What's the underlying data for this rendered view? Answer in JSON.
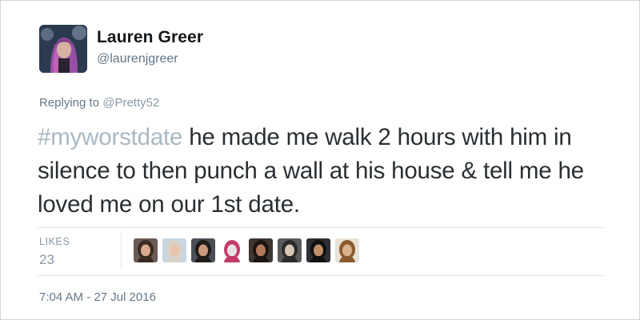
{
  "author": {
    "name": "Lauren Greer",
    "handle": "@laurenjgreer"
  },
  "reply": {
    "prefix": "Replying to",
    "to": "@Pretty52"
  },
  "tweet": {
    "hashtag": "#myworstdate",
    "text": " he made me walk 2 hours with him in silence to then punch a wall at his house & tell me he loved me on our 1st date."
  },
  "likes": {
    "label": "LIKES",
    "count": "23",
    "avatars": [
      {
        "bg": "#6b5a55",
        "face": "#d9a98c",
        "hair": "#3b2a22"
      },
      {
        "bg": "#c9d6e3",
        "face": "#e7c4ae",
        "hair": "#d9d2c6"
      },
      {
        "bg": "#4a4f57",
        "face": "#c99a7c",
        "hair": "#1f1b18"
      },
      {
        "bg": "#ffffff",
        "face": "#e9e3e3",
        "hair": "#c23b6a"
      },
      {
        "bg": "#3e3631",
        "face": "#b27a5a",
        "hair": "#1c1410"
      },
      {
        "bg": "#5a5a5a",
        "face": "#d8c5b5",
        "hair": "#2b2b2b"
      },
      {
        "bg": "#2f2f35",
        "face": "#c28f6a",
        "hair": "#111111"
      },
      {
        "bg": "#e9e1d6",
        "face": "#d9b38e",
        "hair": "#8a5a2e"
      }
    ]
  },
  "timestamp": "7:04 AM - 27 Jul 2016",
  "colors": {
    "name": "#14171a",
    "secondary": "#657786",
    "hashtag": "#aab8c2",
    "body": "#292f33",
    "divider": "#e1e8ed"
  }
}
